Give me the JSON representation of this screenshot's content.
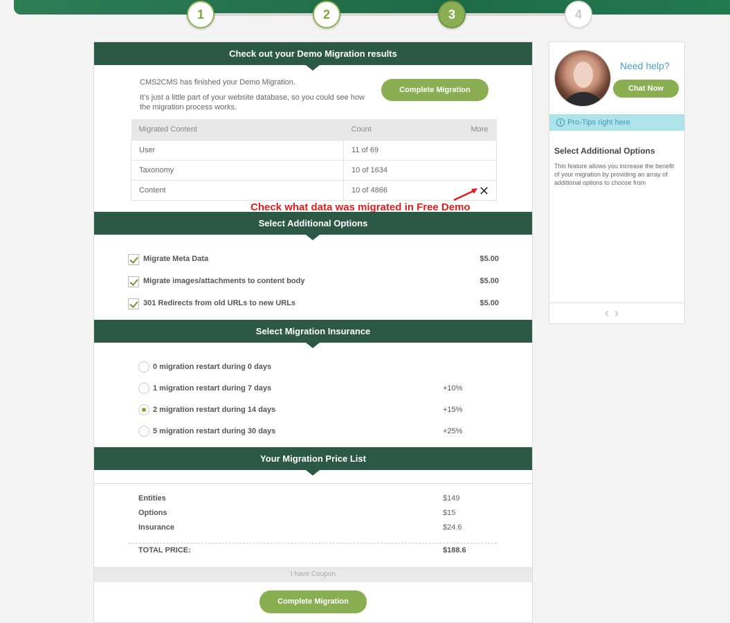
{
  "steps": [
    "1",
    "2",
    "3",
    "4"
  ],
  "results": {
    "heading": "Check out your Demo Migration results",
    "intro_line1": "CMS2CMS has finished your Demo Migration.",
    "intro_line2": "It's just a little part of your website database, so you could see how the migration process works.",
    "complete_button": "Complete Migration",
    "table": {
      "headers": [
        "Migrated Content",
        "Count",
        "More"
      ],
      "rows": [
        {
          "name": "User",
          "count": "11 of 69"
        },
        {
          "name": "Taxonomy",
          "count": "10 of 1634"
        },
        {
          "name": "Content",
          "count": "10 of 4866"
        }
      ]
    },
    "annotation": "Check what data was migrated in Free Demo"
  },
  "options": {
    "heading": "Select Additional Options",
    "items": [
      {
        "label": "Migrate Meta Data",
        "price": "$5.00",
        "checked": true
      },
      {
        "label": "Migrate images/attachments to content body",
        "price": "$5.00",
        "checked": true
      },
      {
        "label": "301 Redirects from old URLs to new URLs",
        "price": "$5.00",
        "checked": true
      }
    ]
  },
  "insurance": {
    "heading": "Select Migration Insurance",
    "items": [
      {
        "label": "0 migration restart during 0 days",
        "pct": "",
        "selected": false
      },
      {
        "label": "1 migration restart during 7 days",
        "pct": "+10%",
        "selected": false
      },
      {
        "label": "2 migration restart during 14 days",
        "pct": "+15%",
        "selected": true
      },
      {
        "label": "5 migration restart during 30 days",
        "pct": "+25%",
        "selected": false
      }
    ]
  },
  "price_list": {
    "heading": "Your Migration Price List",
    "rows": [
      {
        "label": "Entities",
        "value": "$149"
      },
      {
        "label": "Options",
        "value": "$15"
      },
      {
        "label": "Insurance",
        "value": "$24.6"
      }
    ],
    "total_label": "TOTAL PRICE:",
    "total_value": "$188.6",
    "coupon": "I have Coupon",
    "complete_button": "Complete Migration"
  },
  "sidebar": {
    "need_help": "Need help?",
    "chat_button": "Chat Now",
    "pro_tips": "Pro-Tips right here",
    "tip_title": "Select Additional Options",
    "tip_text": "This feature allows you increase the benefit of your migration by providing an array of additional options to choose from"
  },
  "colors": {
    "header_green": "#2c5946",
    "button_green": "#8aae52",
    "annotation_red": "#e31d1d",
    "protips_bg": "#aee3ea"
  }
}
